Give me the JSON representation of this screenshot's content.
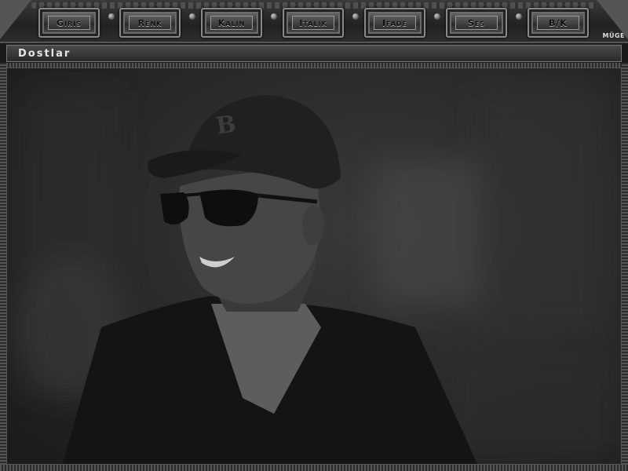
{
  "toolbar": {
    "buttons": [
      {
        "label": "Giris",
        "name": "giris-button"
      },
      {
        "label": "Renk",
        "name": "renk-button"
      },
      {
        "label": "Kalin",
        "name": "kalin-button"
      },
      {
        "label": "Italik",
        "name": "italik-button"
      },
      {
        "label": "Ifade",
        "name": "ifade-button"
      },
      {
        "label": "Ses",
        "name": "ses-button"
      },
      {
        "label": "B/K",
        "name": "bk-button"
      }
    ],
    "brand": "MÜGE"
  },
  "window": {
    "title": "Dostlar"
  },
  "photo": {
    "subject": "photo-icon"
  },
  "colors": {
    "frame": "#2a2a2a",
    "metal": "#777777",
    "text": "#e5e5e5"
  }
}
